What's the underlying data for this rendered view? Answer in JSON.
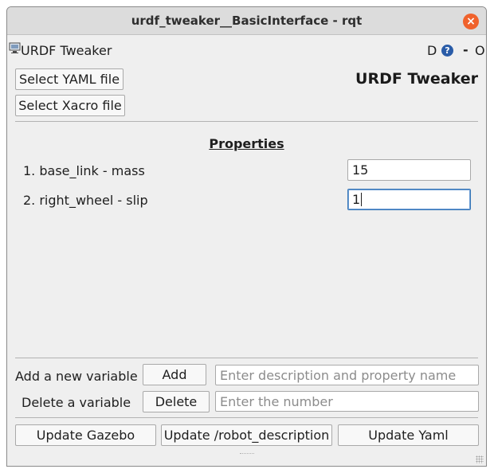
{
  "window": {
    "title": "urdf_tweaker__BasicInterface - rqt",
    "close_glyph": "×"
  },
  "plugin_bar": {
    "title": "URDF Tweaker",
    "help_d": "D",
    "help_q": "?",
    "minimize": "-",
    "float": "O"
  },
  "toolbar": {
    "select_yaml_label": "Select YAML file",
    "select_xacro_label": "Select Xacro file",
    "heading": "URDF Tweaker"
  },
  "properties": {
    "title": "Properties",
    "items": [
      {
        "label": "1. base_link - mass",
        "value": "15"
      },
      {
        "label": "2. right_wheel - slip",
        "value": "1"
      }
    ]
  },
  "variables": {
    "add_label": "Add a new variable",
    "add_button": "Add",
    "add_placeholder": "Enter description and property name",
    "delete_label": "Delete a variable",
    "delete_button": "Delete",
    "delete_placeholder": "Enter the number"
  },
  "actions": {
    "update_gazebo": "Update Gazebo",
    "update_robot_description": "Update /robot_description",
    "update_yaml": "Update Yaml"
  },
  "icons": {
    "plugin": "monitor-icon",
    "close": "close-icon",
    "help": "help-icon"
  },
  "colors": {
    "close_button": "#f0622c",
    "focus_border": "#3a78b8",
    "help_icon": "#2a5ca8"
  }
}
